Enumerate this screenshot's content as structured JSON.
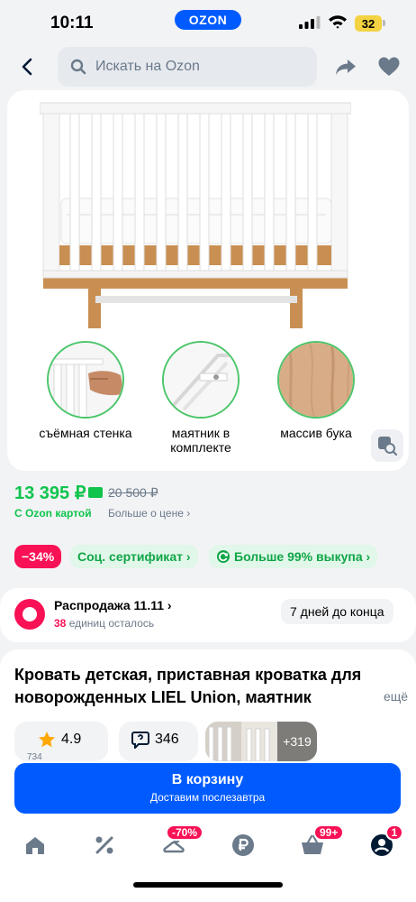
{
  "status_bar": {
    "time": "10:11",
    "brand": "OZON",
    "battery": "32"
  },
  "top_nav": {
    "search_placeholder": "Искать на Ozon"
  },
  "gallery": {
    "features": [
      {
        "label": "съёмная стенка"
      },
      {
        "label": "маятник в комплекте"
      },
      {
        "label": "массив бука"
      }
    ]
  },
  "price": {
    "current": "13 395 ₽",
    "old": "20 500 ₽",
    "card_label": "С Ozon картой",
    "more_label": "Больше о цене ›"
  },
  "chips": {
    "discount": "−34%",
    "certificate": "Соц. сертификат ›",
    "buyout": "Больше 99% выкупа ›"
  },
  "sale": {
    "title": "Распродажа 11.11 ›",
    "units_count": "38",
    "units_text": " единиц осталось",
    "ends": "7 дней до конца"
  },
  "product": {
    "title": "Кровать детская, приставная кроватка для новорожденных LIEL Union, маятник",
    "more": "ещё",
    "rating": "4.9",
    "rating_sub": "734",
    "reviews": "346",
    "photos_more": "+319"
  },
  "cart": {
    "main": "В корзину",
    "sub": "Доставим послезавтра"
  },
  "tabs": {
    "promo_badge": "-70%",
    "cart_badge": "99+",
    "profile_badge": "1"
  },
  "colors": {
    "accent": "#005bff",
    "green": "#10c44c",
    "pink": "#f91155",
    "wood": "#c98f52"
  }
}
